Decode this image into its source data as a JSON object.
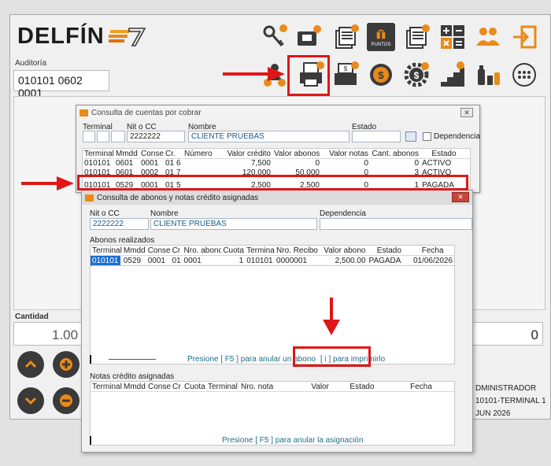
{
  "app": {
    "logo": "DELFÍN",
    "auditoria_label": "Auditoría",
    "auditoria_value": "010101 0602 0001",
    "toolbar_row1": [
      {
        "icon": "keys-icon"
      },
      {
        "icon": "card-wallet-icon"
      },
      {
        "icon": "documents-add-icon"
      },
      {
        "icon": "gift-points-icon",
        "label": "PUNTOS"
      },
      {
        "icon": "documents-search-icon"
      },
      {
        "icon": "calculator-icon"
      },
      {
        "icon": "users-icon"
      },
      {
        "icon": "exit-icon"
      }
    ],
    "toolbar_row2": [
      {
        "icon": "user-money-icon"
      },
      {
        "icon": "print-documents-icon"
      },
      {
        "icon": "cash-register-icon"
      },
      {
        "icon": "dollar-coin-icon"
      },
      {
        "icon": "dollar-gear-icon"
      },
      {
        "icon": "stairs-icon"
      },
      {
        "icon": "bottles-icon"
      },
      {
        "icon": "more-icon"
      }
    ],
    "cantidad_label": "Cantidad",
    "cantidad_value": "1.00",
    "total_value": "0",
    "user_lines": [
      "DMINISTRADOR",
      "10101-TERMINAL 1",
      "JUN 2026"
    ]
  },
  "win1": {
    "title": "Consulta de cuentas por cobrar",
    "labels": {
      "terminal": "Terminal",
      "nit": "Nit o CC",
      "nombre": "Nombre",
      "estado": "Estado",
      "dependencia": "Dependencia"
    },
    "nit_value": "2222222",
    "nombre_value": "CLIENTE PRUEBAS",
    "columns": [
      "Terminal",
      "Mmdd",
      "Conse",
      "Cr.",
      "Número",
      "Valor crédito",
      "Valor abonos",
      "Valor notas",
      "Cant. abonos",
      "Estado"
    ],
    "rows": [
      [
        "010101",
        "0601",
        "0001",
        "01",
        "6",
        "7,500",
        "0",
        "0",
        "0",
        "ACTIVO"
      ],
      [
        "010101",
        "0601",
        "0002",
        "01",
        "7",
        "120,000",
        "50,000",
        "0",
        "3",
        "ACTIVO"
      ],
      [
        "010101",
        "0529",
        "0001",
        "01",
        "5",
        "2,500",
        "2,500",
        "0",
        "1",
        "PAGADA"
      ]
    ]
  },
  "win2": {
    "title": "Consulta de abonos y notas crédito asignadas",
    "labels": {
      "nit": "Nit o CC",
      "nombre": "Nombre",
      "dependencia": "Dependencia"
    },
    "nit_value": "2222222",
    "nombre_value": "CLIENTE PRUEBAS",
    "abonos_title": "Abonos realizados",
    "abonos_columns": [
      "Terminal",
      "Mmdd",
      "Conse",
      "Cr",
      "Nro. abono",
      "Cuota",
      "Terminal",
      "Nro. Recibo",
      "Valor abono",
      "Estado",
      "Fecha"
    ],
    "abonos_rows": [
      [
        "010101",
        "0529",
        "0001",
        "01",
        "0001",
        "1",
        "010101",
        "0000001",
        "2,500.00",
        "PAGADA",
        "01/06/2026"
      ]
    ],
    "abonos_hint_anular": "Presione [ F5 ] para anular un abono",
    "abonos_hint_imprimir": "[ i ] para imprimirlo",
    "notas_title": "Notas crédito asignadas",
    "notas_columns": [
      "Terminal",
      "Mmdd",
      "Conse",
      "Cr",
      "Cuota",
      "Terminal",
      "Nro. nota",
      "Valor",
      "Estado",
      "Fecha"
    ],
    "notas_hint": "Presione [ F5 ] para anular la asignación"
  },
  "colors": {
    "annotation": "#e01616",
    "accent": "#e98a1a",
    "icon_dark": "#3a3a3a",
    "hint": "#1f6d8c"
  }
}
